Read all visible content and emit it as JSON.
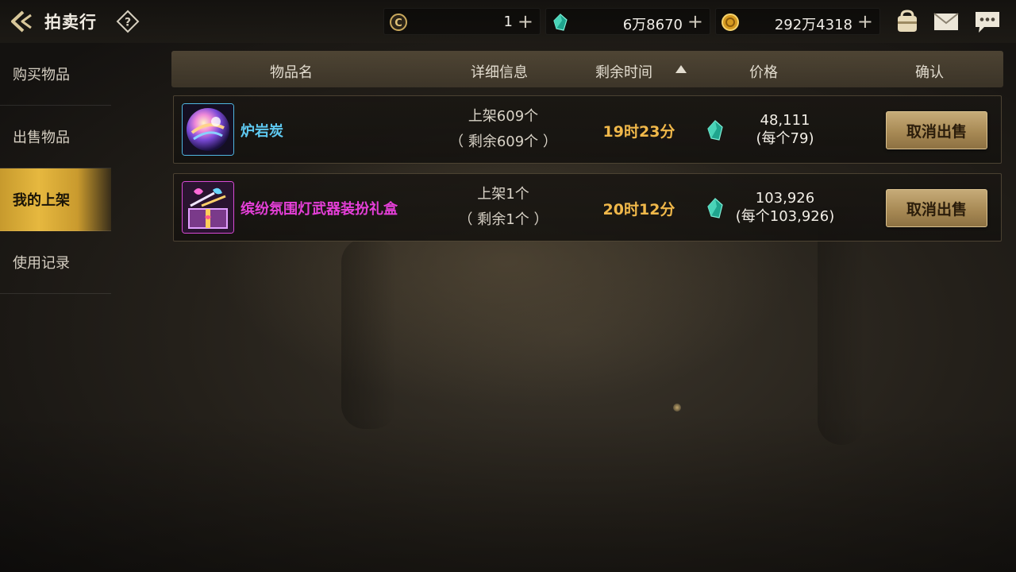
{
  "header": {
    "title": "拍卖行",
    "help_label": "?",
    "currencies": [
      {
        "icon": "c-coin-icon",
        "value": "1",
        "plus": "+"
      },
      {
        "icon": "green-gem-icon",
        "value": "6万8670",
        "plus": "+"
      },
      {
        "icon": "gold-coin-icon",
        "value": "292万4318",
        "plus": "+"
      }
    ],
    "right_icons": [
      "pouch-icon",
      "mail-icon",
      "chat-icon"
    ]
  },
  "sidebar": {
    "items": [
      {
        "label": "购买物品",
        "active": false
      },
      {
        "label": "出售物品",
        "active": false
      },
      {
        "label": "我的上架",
        "active": true
      },
      {
        "label": "使用记录",
        "active": false
      }
    ]
  },
  "table": {
    "columns": [
      "物品名",
      "详细信息",
      "剩余时间",
      "价格",
      "确认"
    ],
    "sort_column": "剩余时间",
    "sort_direction": "ascending",
    "rows": [
      {
        "name": "炉岩炭",
        "name_color": "#5ec8f0",
        "icon": "lava-orb-icon",
        "detail_line1": "上架609个",
        "detail_line2": "（ 剩余609个 ）",
        "time": "19时23分",
        "price_total": "48,111",
        "price_each": "(每个79)",
        "button": "取消出售"
      },
      {
        "name": "缤纷氛围灯武器装扮礼盒",
        "name_color": "#e53fd8",
        "icon": "gift-box-icon",
        "detail_line1": "上架1个",
        "detail_line2": "（ 剩余1个 ）",
        "time": "20时12分",
        "price_total": "103,926",
        "price_each": "(每个103,926)",
        "button": "取消出售"
      }
    ]
  },
  "colors": {
    "accent_gold": "#e6b83f",
    "time_orange": "#f0b84a",
    "button_gold": "#b6996a"
  }
}
